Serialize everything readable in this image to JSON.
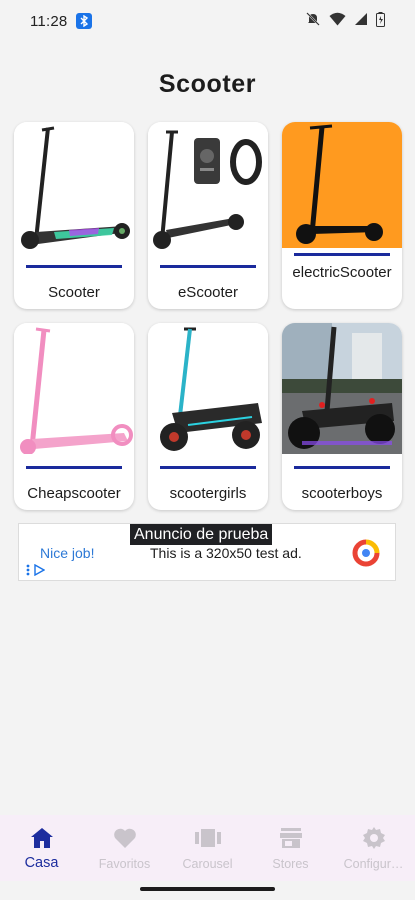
{
  "status_bar": {
    "time": "11:28"
  },
  "page": {
    "title": "Scooter"
  },
  "cards": [
    {
      "label": "Scooter"
    },
    {
      "label": "eScooter"
    },
    {
      "label": "electricScooter"
    },
    {
      "label": "Cheapscooter"
    },
    {
      "label": "scootergirls"
    },
    {
      "label": "scooterboys"
    }
  ],
  "ad": {
    "badge": "Anuncio de prueba",
    "nice": "Nice job!",
    "text": "This is a 320x50 test ad."
  },
  "nav": {
    "items": [
      {
        "label": "Casa",
        "icon": "home-icon",
        "active": true
      },
      {
        "label": "Favoritos",
        "icon": "heart-icon"
      },
      {
        "label": "Carousel",
        "icon": "carousel-icon"
      },
      {
        "label": "Stores",
        "icon": "store-icon"
      },
      {
        "label": "Configur…",
        "icon": "gear-icon"
      }
    ]
  },
  "colors": {
    "accent": "#1d2d9e",
    "orange": "#ff9a1f",
    "nav_bg": "#f7eef8"
  }
}
